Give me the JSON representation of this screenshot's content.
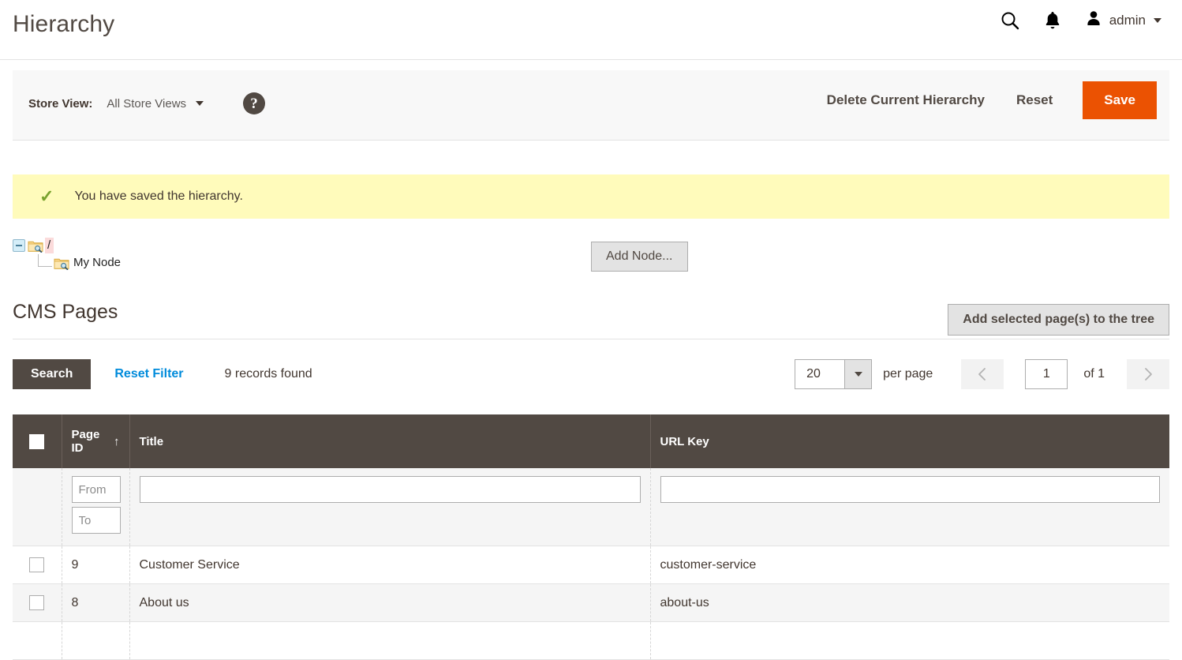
{
  "header": {
    "title": "Hierarchy",
    "search_icon": "search-icon",
    "notifications_icon": "bell-icon",
    "user_icon": "user-avatar-icon",
    "user_name": "admin"
  },
  "toolbar": {
    "store_view_label": "Store View:",
    "store_view_value": "All Store Views",
    "help_icon": "question-mark-icon",
    "delete_label": "Delete Current Hierarchy",
    "reset_label": "Reset",
    "save_label": "Save",
    "save_color": "#eb5202"
  },
  "message": {
    "icon": "check-icon",
    "text": "You have saved the hierarchy.",
    "background": "#fffbbb",
    "icon_color": "#79a22e"
  },
  "tree": {
    "root": {
      "toggle_icon": "collapse-minus-icon",
      "folder_icon": "folder-search-icon",
      "label": "/",
      "selected": true
    },
    "child": {
      "folder_icon": "folder-search-icon",
      "label": "My Node",
      "selected": false
    },
    "add_node_label": "Add Node..."
  },
  "cms_pages": {
    "section_title": "CMS Pages",
    "add_selected_label": "Add selected page(s) to the tree",
    "search_label": "Search",
    "reset_filter_label": "Reset Filter",
    "reset_filter_color": "#008bdb",
    "records_found": "9 records found",
    "per_page_value": "20",
    "per_page_label": "per page",
    "prev_icon": "chevron-left-icon",
    "next_icon": "chevron-right-icon",
    "page_value": "1",
    "of_label": "of 1",
    "columns": [
      {
        "key": "checkbox",
        "label": ""
      },
      {
        "key": "page_id",
        "label": "Page ID",
        "sort": "↑"
      },
      {
        "key": "title",
        "label": "Title"
      },
      {
        "key": "url_key",
        "label": "URL Key"
      }
    ],
    "filters": {
      "id_from_placeholder": "From",
      "id_to_placeholder": "To",
      "id_from_value": "",
      "id_to_value": "",
      "title_value": "",
      "url_key_value": ""
    },
    "rows": [
      {
        "page_id": "9",
        "title": "Customer Service",
        "url_key": "customer-service"
      },
      {
        "page_id": "8",
        "title": "About us",
        "url_key": "about-us"
      },
      {
        "page_id": "",
        "title": "",
        "url_key": ""
      }
    ]
  }
}
